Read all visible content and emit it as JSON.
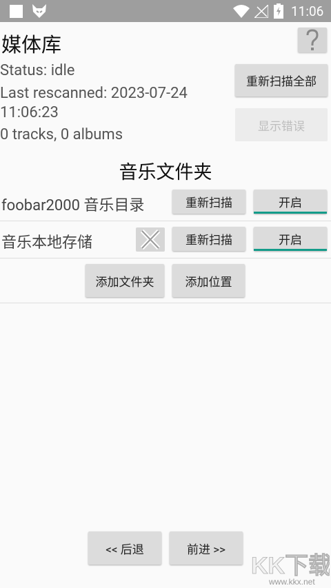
{
  "statusbar": {
    "time": "11:06"
  },
  "header": {
    "title": "媒体库",
    "help_icon": "question-mark-icon"
  },
  "status": {
    "status_text": "Status: idle",
    "rescanned_line1": "Last rescanned: 2023-07-24",
    "rescanned_line2": "11:06:23",
    "counts": "0 tracks, 0 albums"
  },
  "buttons": {
    "rescan_all": "重新扫描全部",
    "show_errors": "显示错误",
    "add_folder": "添加文件夹",
    "add_location": "添加位置",
    "back": "<< 后退",
    "forward": "前进 >>"
  },
  "folders_section": {
    "title": "音乐文件夹",
    "items": [
      {
        "label": "foobar2000 音乐目录",
        "rescan": "重新扫描",
        "toggle": "开启"
      },
      {
        "label": "音乐本地存储",
        "rescan": "重新扫描",
        "toggle": "开启"
      }
    ]
  },
  "watermark": {
    "main": "KK下载",
    "sub": "www.kkx.net"
  },
  "colors": {
    "accent": "#139c8a",
    "statusbar": "#9e9e9e",
    "button": "#dcdcdc"
  }
}
